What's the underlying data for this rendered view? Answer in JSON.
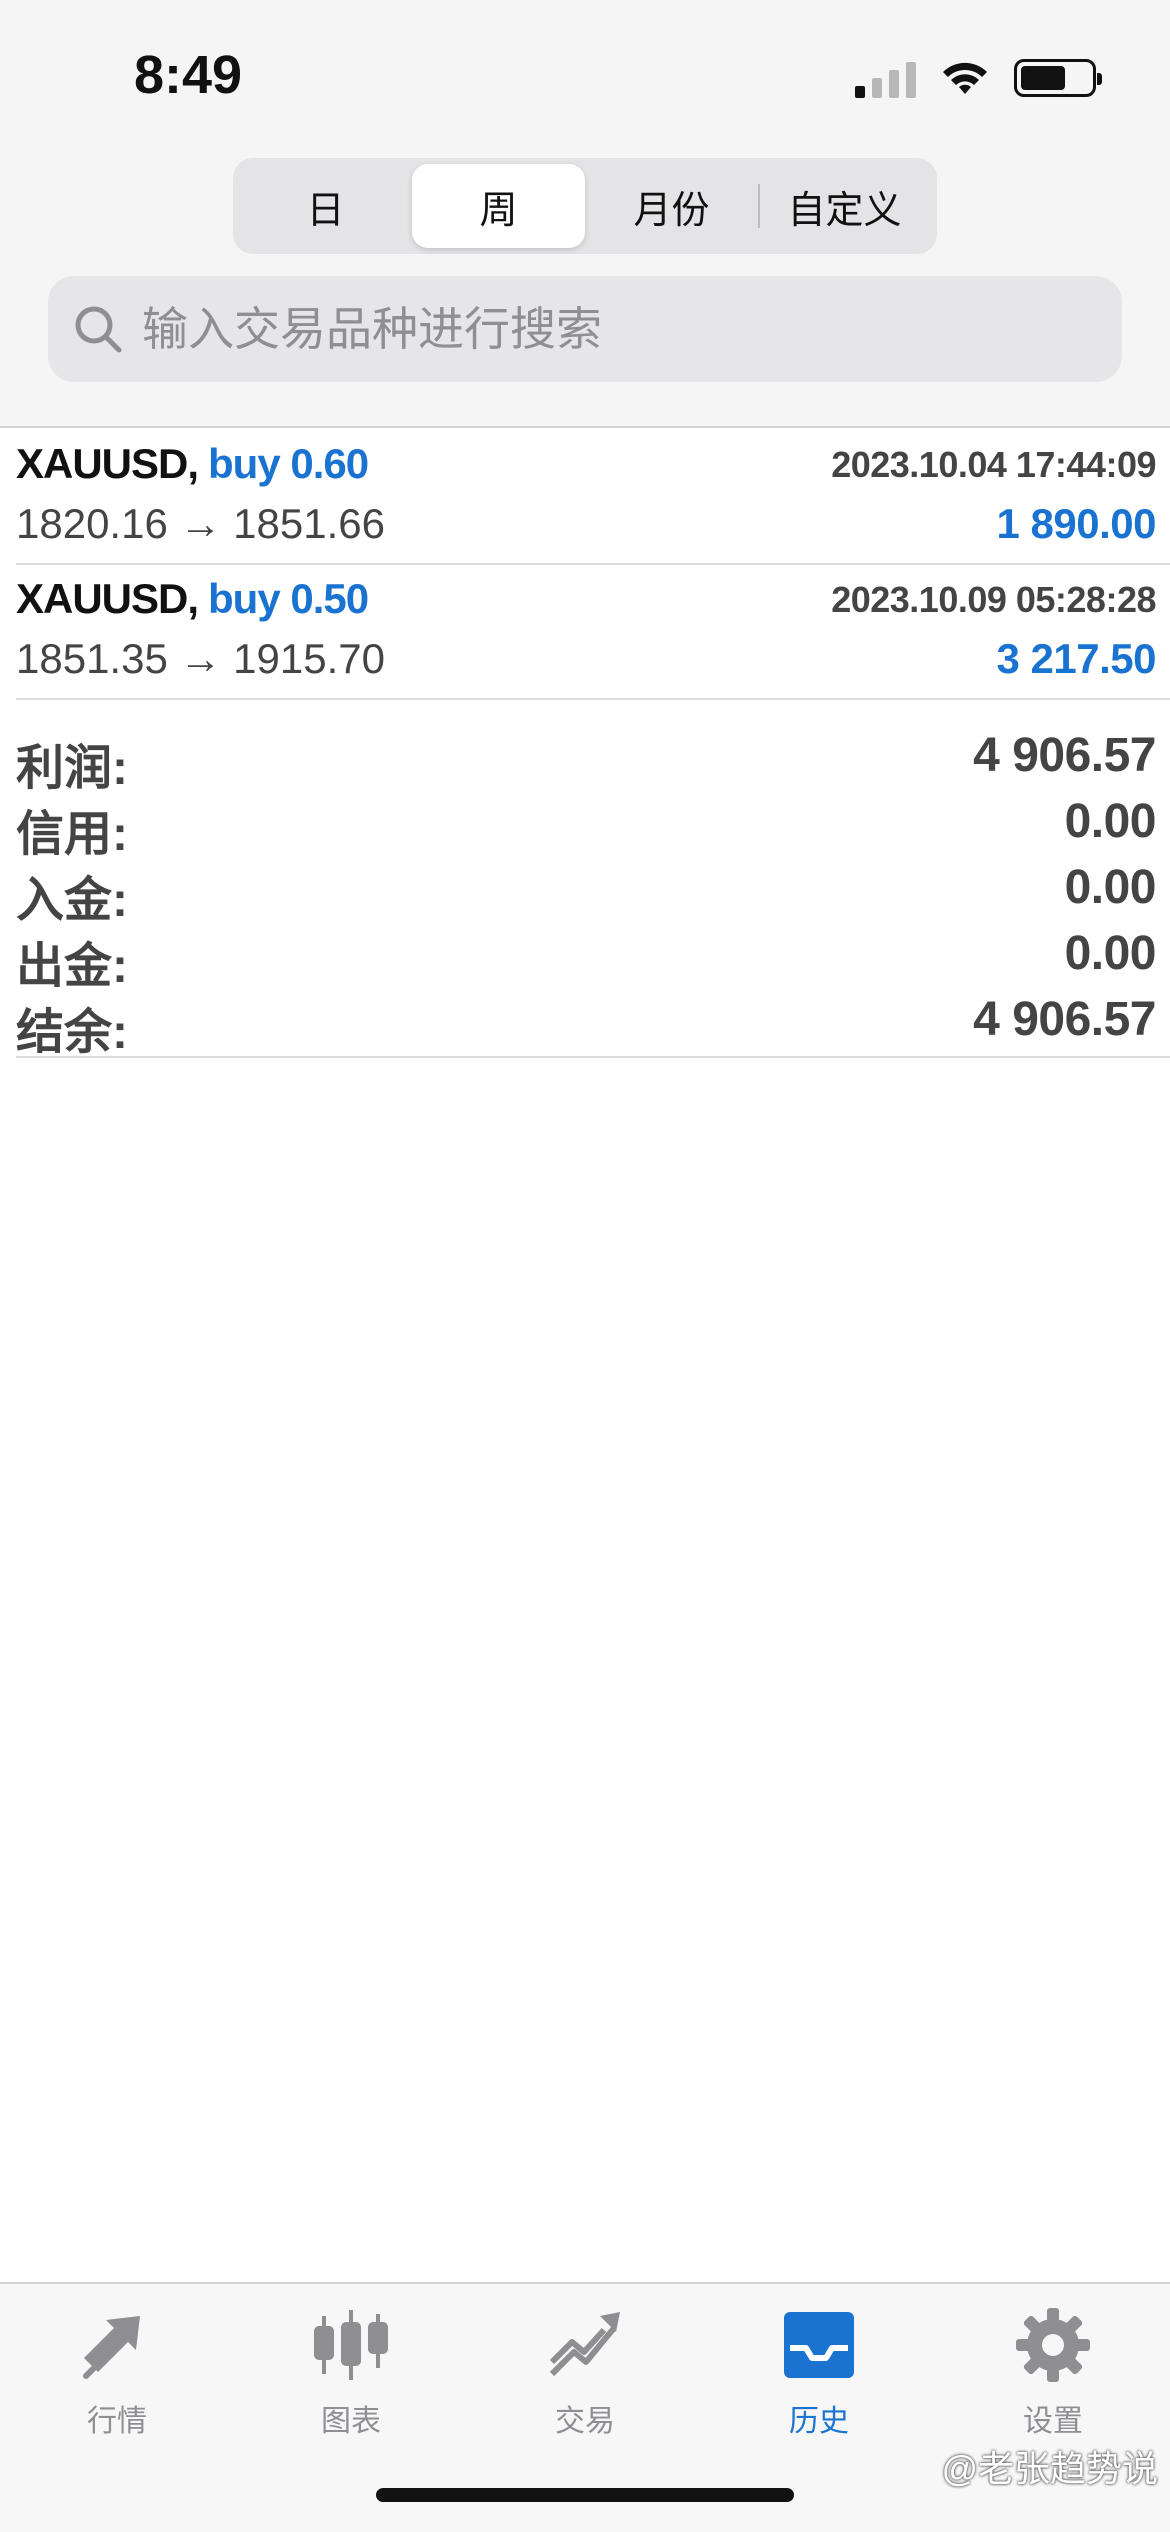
{
  "status_bar": {
    "time": "8:49"
  },
  "period_tabs": [
    {
      "label": "日",
      "active": false
    },
    {
      "label": "周",
      "active": true
    },
    {
      "label": "月份",
      "active": false
    },
    {
      "label": "自定义",
      "active": false
    }
  ],
  "search": {
    "placeholder": "输入交易品种进行搜索",
    "icon": "search-icon"
  },
  "trades": [
    {
      "symbol": "XAUUSD,",
      "side": "buy 0.60",
      "time": "2023.10.04 17:44:09",
      "prices": "1820.16 → 1851.66",
      "profit": "1 890.00"
    },
    {
      "symbol": "XAUUSD,",
      "side": "buy 0.50",
      "time": "2023.10.09 05:28:28",
      "prices": "1851.35 → 1915.70",
      "profit": "3 217.50"
    }
  ],
  "summary": [
    {
      "label": "利润:",
      "value": "4 906.57"
    },
    {
      "label": "信用:",
      "value": "0.00"
    },
    {
      "label": "入金:",
      "value": "0.00"
    },
    {
      "label": "出金:",
      "value": "0.00"
    },
    {
      "label": "结余:",
      "value": "4 906.57"
    }
  ],
  "tabbar": [
    {
      "label": "行情",
      "icon": "quotes-arrows-icon",
      "active": false
    },
    {
      "label": "图表",
      "icon": "candlestick-icon",
      "active": false
    },
    {
      "label": "交易",
      "icon": "trade-chart-icon",
      "active": false
    },
    {
      "label": "历史",
      "icon": "inbox-tray-icon",
      "active": true
    },
    {
      "label": "设置",
      "icon": "gear-icon",
      "active": false
    }
  ],
  "watermark": "@老张趋势说",
  "colors": {
    "accent": "#1a73d1",
    "inactive": "#8e8e93",
    "text": "#444444"
  }
}
